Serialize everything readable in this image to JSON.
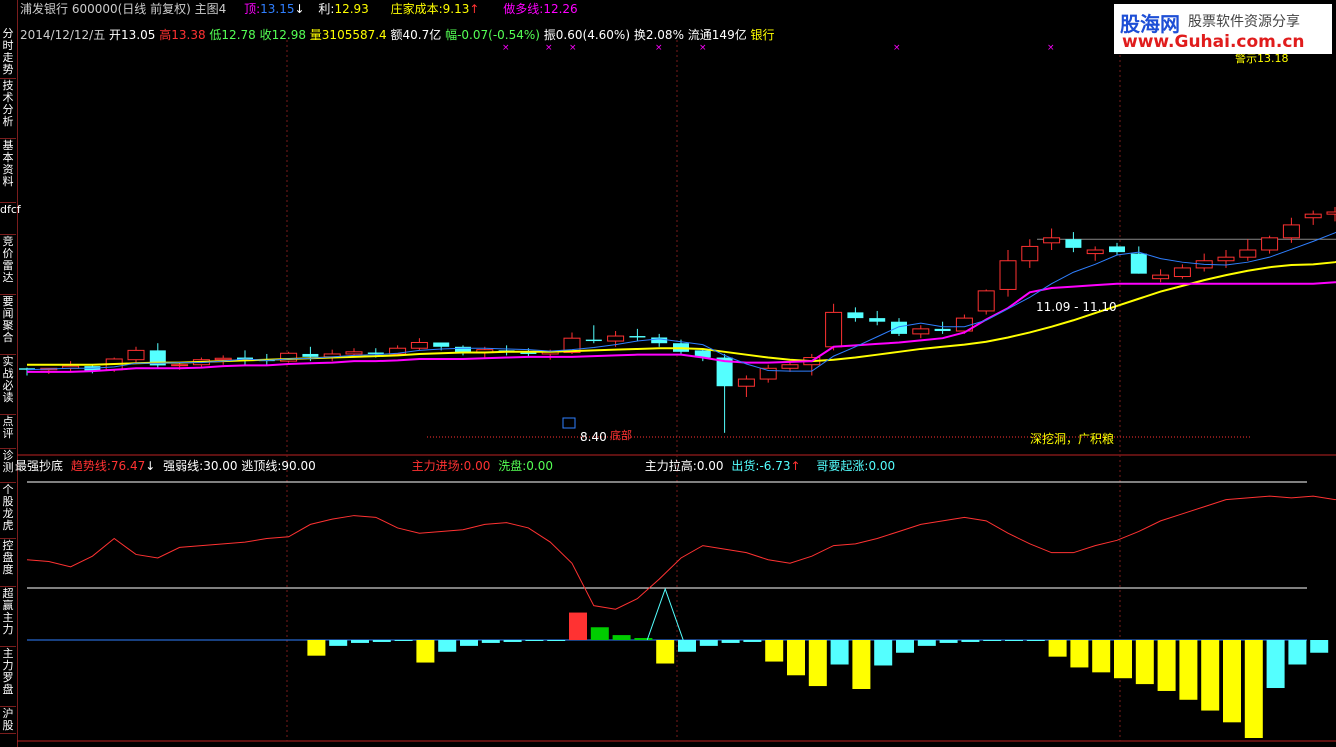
{
  "sidebar": {
    "items": [
      "分时走势",
      "技术分析",
      "基本资料",
      "dfcf",
      "竞价雷达",
      "要闻聚合",
      "实战必读",
      "点评",
      "诊测",
      "个股龙虎",
      "控盘度",
      "超赢主力",
      "主力罗盘",
      "沪股"
    ]
  },
  "header": {
    "stock": "浦发银行 600000(日线 前复权) 主图4",
    "ding_label": "顶:",
    "ding_value": "13.15",
    "li_label": "利:",
    "li_value": "12.93",
    "cost_label": "庄家成本:",
    "cost_value": "9.13",
    "duo_label": "做多线:",
    "duo_value": "12.26"
  },
  "quote": {
    "date": "2014/12/12/五",
    "open": "开13.05",
    "high": "高13.38",
    "low": "低12.78",
    "close": "收12.98",
    "volume": "量3105587.4",
    "amount": "额40.7亿",
    "change": "幅-0.07(-0.54%)",
    "amplitude": "振0.60(4.60%)",
    "turnover": "换2.08%",
    "float": "流通149亿",
    "industry": "银行"
  },
  "annotations": {
    "range_label": "11.09 - 11.10",
    "price_low": "8.40",
    "mark1": "底部",
    "mark2": "深挖洞，广积粮",
    "top_label": "警示13.18"
  },
  "indicator": {
    "name": "最强抄底",
    "trend_label": "趋势线:",
    "trend_value": "76.47",
    "strong_label": "强弱线:",
    "strong_value": "30.00",
    "escape_label": "逃顶线:",
    "escape_value": "90.00",
    "enter_label": "主力进场:",
    "enter_value": "0.00",
    "wash_label": "洗盘:",
    "wash_value": "0.00",
    "pull_label": "主力拉高:",
    "pull_value": "0.00",
    "out_label": "出货:",
    "out_value": "-6.73",
    "rise_label": "哥要起涨:",
    "rise_value": "0.00"
  },
  "logo": {
    "name": "股海网",
    "tagline": "股票软件资源分享",
    "url": "www.Guhai.com.cn"
  },
  "colors": {
    "up": "#ff3232",
    "down": "#54ffff",
    "ma1": "#2f7fff",
    "ma2": "#ffff00",
    "ma3": "#ff00ff"
  },
  "chart_data": {
    "type": "candlestick",
    "candles": [
      [
        9.3,
        9.31,
        9.2,
        9.28
      ],
      [
        9.28,
        9.3,
        9.22,
        9.3
      ],
      [
        9.3,
        9.4,
        9.25,
        9.33
      ],
      [
        9.33,
        9.35,
        9.23,
        9.27
      ],
      [
        9.28,
        9.45,
        9.25,
        9.43
      ],
      [
        9.42,
        9.6,
        9.38,
        9.55
      ],
      [
        9.55,
        9.65,
        9.3,
        9.34
      ],
      [
        9.34,
        9.39,
        9.28,
        9.35
      ],
      [
        9.35,
        9.45,
        9.3,
        9.42
      ],
      [
        9.42,
        9.48,
        9.35,
        9.44
      ],
      [
        9.45,
        9.55,
        9.35,
        9.41
      ],
      [
        9.42,
        9.5,
        9.35,
        9.4
      ],
      [
        9.4,
        9.53,
        9.38,
        9.51
      ],
      [
        9.5,
        9.6,
        9.4,
        9.46
      ],
      [
        9.46,
        9.56,
        9.4,
        9.5
      ],
      [
        9.5,
        9.58,
        9.45,
        9.53
      ],
      [
        9.52,
        9.58,
        9.45,
        9.5
      ],
      [
        9.5,
        9.62,
        9.48,
        9.58
      ],
      [
        9.58,
        9.72,
        9.55,
        9.66
      ],
      [
        9.66,
        9.66,
        9.55,
        9.6
      ],
      [
        9.6,
        9.62,
        9.48,
        9.52
      ],
      [
        9.52,
        9.6,
        9.45,
        9.56
      ],
      [
        9.55,
        9.62,
        9.48,
        9.52
      ],
      [
        9.52,
        9.58,
        9.46,
        9.5
      ],
      [
        9.5,
        9.56,
        9.42,
        9.53
      ],
      [
        9.52,
        9.8,
        9.5,
        9.72
      ],
      [
        9.7,
        9.9,
        9.65,
        9.68
      ],
      [
        9.68,
        9.82,
        9.6,
        9.75
      ],
      [
        9.75,
        9.85,
        9.68,
        9.73
      ],
      [
        9.73,
        9.78,
        9.6,
        9.65
      ],
      [
        9.65,
        9.7,
        9.5,
        9.53
      ],
      [
        9.55,
        9.58,
        9.4,
        9.45
      ],
      [
        9.45,
        9.5,
        8.4,
        9.05
      ],
      [
        9.05,
        9.2,
        8.9,
        9.15
      ],
      [
        9.15,
        9.35,
        9.1,
        9.3
      ],
      [
        9.3,
        9.4,
        9.25,
        9.35
      ],
      [
        9.35,
        9.5,
        9.2,
        9.45
      ],
      [
        9.6,
        10.2,
        9.55,
        10.08
      ],
      [
        10.08,
        10.15,
        9.95,
        10.0
      ],
      [
        10.0,
        10.1,
        9.9,
        9.95
      ],
      [
        9.95,
        10.0,
        9.75,
        9.78
      ],
      [
        9.78,
        9.9,
        9.72,
        9.85
      ],
      [
        9.85,
        9.95,
        9.78,
        9.82
      ],
      [
        9.82,
        10.05,
        9.78,
        10.0
      ],
      [
        10.1,
        10.4,
        10.05,
        10.38
      ],
      [
        10.4,
        10.95,
        10.3,
        10.8
      ],
      [
        10.8,
        11.1,
        10.7,
        11.0
      ],
      [
        11.05,
        11.25,
        10.95,
        11.12
      ],
      [
        11.1,
        11.2,
        10.92,
        10.98
      ],
      [
        10.9,
        11.0,
        10.8,
        10.95
      ],
      [
        11.0,
        11.05,
        10.88,
        10.92
      ],
      [
        10.9,
        11.0,
        10.62,
        10.62
      ],
      [
        10.55,
        10.68,
        10.5,
        10.6
      ],
      [
        10.58,
        10.75,
        10.55,
        10.7
      ],
      [
        10.7,
        10.9,
        10.65,
        10.8
      ],
      [
        10.8,
        10.95,
        10.7,
        10.85
      ],
      [
        10.85,
        11.1,
        10.8,
        10.95
      ],
      [
        10.95,
        11.15,
        10.9,
        11.12
      ],
      [
        11.12,
        11.4,
        11.05,
        11.3
      ],
      [
        11.4,
        11.5,
        11.3,
        11.45
      ],
      [
        11.45,
        11.55,
        11.35,
        11.48
      ],
      [
        11.5,
        12.1,
        11.45,
        11.95
      ],
      [
        11.95,
        12.0,
        11.7,
        11.7
      ],
      [
        11.8,
        12.5,
        11.75,
        12.35
      ],
      [
        12.4,
        12.55,
        12.15,
        12.2
      ],
      [
        12.2,
        12.8,
        12.15,
        12.7
      ],
      [
        12.7,
        12.85,
        12.4,
        12.55
      ],
      [
        12.5,
        13.05,
        12.4,
        12.92
      ],
      [
        12.9,
        13.3,
        12.85,
        13.15
      ],
      [
        13.05,
        13.38,
        12.9,
        13.25
      ],
      [
        13.0,
        13.18,
        12.6,
        12.6
      ],
      [
        12.6,
        13.0,
        12.3,
        12.95
      ],
      [
        12.95,
        13.1,
        12.8,
        12.9
      ],
      [
        12.88,
        13.0,
        12.75,
        12.85
      ]
    ],
    "ma_fast": [
      9.28,
      9.29,
      9.3,
      9.3,
      9.32,
      9.37,
      9.37,
      9.38,
      9.38,
      9.4,
      9.43,
      9.41,
      9.43,
      9.44,
      9.46,
      9.48,
      9.49,
      9.51,
      9.55,
      9.57,
      9.58,
      9.58,
      9.57,
      9.56,
      9.54,
      9.56,
      9.59,
      9.63,
      9.68,
      9.71,
      9.67,
      9.63,
      9.48,
      9.36,
      9.27,
      9.26,
      9.26,
      9.47,
      9.6,
      9.74,
      9.88,
      9.93,
      9.88,
      9.88,
      9.97,
      10.13,
      10.29,
      10.48,
      10.64,
      10.75,
      10.88,
      10.92,
      10.83,
      10.78,
      10.75,
      10.74,
      10.78,
      10.85,
      10.96,
      11.07,
      11.19,
      11.35,
      11.46,
      11.63,
      11.75,
      11.96,
      12.11,
      12.3,
      12.47,
      12.61,
      12.72,
      12.82,
      12.9,
      12.88
    ],
    "ma_slow": [
      9.35,
      9.35,
      9.35,
      9.35,
      9.36,
      9.37,
      9.38,
      9.38,
      9.39,
      9.4,
      9.41,
      9.42,
      9.43,
      9.44,
      9.45,
      9.46,
      9.47,
      9.48,
      9.5,
      9.51,
      9.52,
      9.52,
      9.53,
      9.53,
      9.53,
      9.54,
      9.55,
      9.56,
      9.57,
      9.58,
      9.58,
      9.57,
      9.53,
      9.49,
      9.45,
      9.42,
      9.4,
      9.42,
      9.45,
      9.49,
      9.53,
      9.57,
      9.6,
      9.63,
      9.67,
      9.73,
      9.8,
      9.88,
      9.97,
      10.07,
      10.17,
      10.27,
      10.37,
      10.45,
      10.53,
      10.6,
      10.66,
      10.71,
      10.74,
      10.75,
      10.78,
      10.85,
      10.95,
      11.08,
      11.22,
      11.38,
      11.55,
      11.73,
      11.92,
      12.11,
      12.3,
      12.45,
      12.58,
      12.7
    ],
    "ma_step": [
      9.25,
      9.25,
      9.25,
      9.26,
      9.28,
      9.3,
      9.3,
      9.3,
      9.31,
      9.33,
      9.34,
      9.34,
      9.36,
      9.37,
      9.38,
      9.4,
      9.4,
      9.41,
      9.43,
      9.43,
      9.43,
      9.44,
      9.45,
      9.46,
      9.46,
      9.46,
      9.47,
      9.48,
      9.49,
      9.49,
      9.49,
      9.45,
      9.4,
      9.38,
      9.38,
      9.39,
      9.4,
      9.6,
      9.62,
      9.64,
      9.66,
      9.69,
      9.72,
      9.8,
      9.98,
      10.14,
      10.36,
      10.42,
      10.44,
      10.46,
      10.48,
      10.48,
      10.48,
      10.48,
      10.48,
      10.48,
      10.48,
      10.48,
      10.48,
      10.48,
      10.5,
      10.52,
      10.54,
      10.58,
      10.58,
      10.6,
      10.8,
      11.1,
      11.3,
      11.6,
      12.0,
      12.1,
      12.1,
      12.1
    ],
    "trend_line": [
      46,
      45,
      42,
      48,
      58,
      49,
      47,
      53,
      54,
      55,
      56,
      58,
      59,
      66,
      69,
      71,
      70,
      64,
      61,
      62,
      63,
      66,
      67,
      64,
      56,
      44,
      20,
      18,
      24,
      35,
      47,
      54,
      52,
      50,
      46,
      44,
      48,
      54,
      55,
      58,
      62,
      66,
      68,
      70,
      68,
      61,
      55,
      50,
      50,
      54,
      57,
      62,
      68,
      72,
      76,
      80,
      81,
      82,
      81,
      82,
      80,
      82,
      85,
      84,
      84,
      85,
      84,
      72,
      71,
      71,
      70,
      69,
      68,
      67
    ],
    "strong_line": 30,
    "escape_line": 90,
    "pivot_spike": {
      "index": 29,
      "value": 30
    },
    "flow_bars": [
      {
        "i": 13,
        "v": -1.6,
        "c": "y"
      },
      {
        "i": 14,
        "v": -0.6,
        "c": "c"
      },
      {
        "i": 15,
        "v": -0.3,
        "c": "c"
      },
      {
        "i": 16,
        "v": -0.2,
        "c": "c"
      },
      {
        "i": 17,
        "v": -0.1,
        "c": "c"
      },
      {
        "i": 18,
        "v": -2.3,
        "c": "y"
      },
      {
        "i": 19,
        "v": -1.2,
        "c": "c"
      },
      {
        "i": 20,
        "v": -0.6,
        "c": "c"
      },
      {
        "i": 21,
        "v": -0.3,
        "c": "c"
      },
      {
        "i": 22,
        "v": -0.2,
        "c": "c"
      },
      {
        "i": 23,
        "v": -0.1,
        "c": "c"
      },
      {
        "i": 24,
        "v": -0.1,
        "c": "c"
      },
      {
        "i": 25,
        "v": 2.8,
        "c": "r"
      },
      {
        "i": 26,
        "v": 1.3,
        "c": "g"
      },
      {
        "i": 27,
        "v": 0.5,
        "c": "g"
      },
      {
        "i": 28,
        "v": 0.2,
        "c": "g"
      },
      {
        "i": 29,
        "v": -2.4,
        "c": "y"
      },
      {
        "i": 30,
        "v": -1.2,
        "c": "c"
      },
      {
        "i": 31,
        "v": -0.6,
        "c": "c"
      },
      {
        "i": 32,
        "v": -0.3,
        "c": "c"
      },
      {
        "i": 33,
        "v": -0.2,
        "c": "c"
      },
      {
        "i": 34,
        "v": -2.2,
        "c": "y"
      },
      {
        "i": 35,
        "v": -3.6,
        "c": "y"
      },
      {
        "i": 36,
        "v": -4.7,
        "c": "y"
      },
      {
        "i": 37,
        "v": -2.5,
        "c": "c"
      },
      {
        "i": 38,
        "v": -5.0,
        "c": "y"
      },
      {
        "i": 39,
        "v": -2.6,
        "c": "c"
      },
      {
        "i": 40,
        "v": -1.3,
        "c": "c"
      },
      {
        "i": 41,
        "v": -0.6,
        "c": "c"
      },
      {
        "i": 42,
        "v": -0.3,
        "c": "c"
      },
      {
        "i": 43,
        "v": -0.2,
        "c": "c"
      },
      {
        "i": 44,
        "v": -0.1,
        "c": "c"
      },
      {
        "i": 45,
        "v": -0.1,
        "c": "c"
      },
      {
        "i": 46,
        "v": -0.1,
        "c": "c"
      },
      {
        "i": 47,
        "v": -1.7,
        "c": "y"
      },
      {
        "i": 48,
        "v": -2.8,
        "c": "y"
      },
      {
        "i": 49,
        "v": -3.3,
        "c": "y"
      },
      {
        "i": 50,
        "v": -3.9,
        "c": "y"
      },
      {
        "i": 51,
        "v": -4.5,
        "c": "y"
      },
      {
        "i": 52,
        "v": -5.2,
        "c": "y"
      },
      {
        "i": 53,
        "v": -6.1,
        "c": "y"
      },
      {
        "i": 54,
        "v": -7.2,
        "c": "y"
      },
      {
        "i": 55,
        "v": -8.4,
        "c": "y"
      },
      {
        "i": 56,
        "v": -10.0,
        "c": "y"
      },
      {
        "i": 57,
        "v": -4.9,
        "c": "c"
      },
      {
        "i": 58,
        "v": -2.5,
        "c": "c"
      },
      {
        "i": 59,
        "v": -1.3,
        "c": "c"
      }
    ]
  }
}
